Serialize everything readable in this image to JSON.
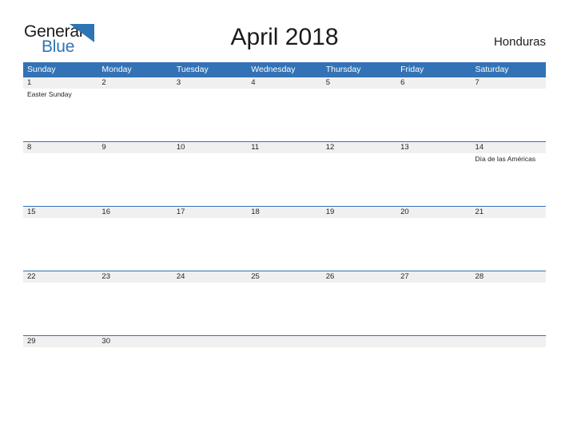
{
  "brand": {
    "name_part1": "General",
    "name_part2": "Blue",
    "triangle_icon": "triangle-right-icon",
    "accent_color": "#2e74b5"
  },
  "header": {
    "title": "April 2018",
    "country": "Honduras"
  },
  "colors": {
    "header_blue": "#3372b4",
    "row_band_gray": "#f0f0f0",
    "text": "#231f20",
    "header_text": "#ffffff"
  },
  "calendar": {
    "month": "April",
    "year": "2018",
    "day_headers": [
      "Sunday",
      "Monday",
      "Tuesday",
      "Wednesday",
      "Thursday",
      "Friday",
      "Saturday"
    ],
    "weeks": [
      {
        "days": [
          {
            "number": "1",
            "events": [
              "Easter Sunday"
            ]
          },
          {
            "number": "2",
            "events": []
          },
          {
            "number": "3",
            "events": []
          },
          {
            "number": "4",
            "events": []
          },
          {
            "number": "5",
            "events": []
          },
          {
            "number": "6",
            "events": []
          },
          {
            "number": "7",
            "events": []
          }
        ]
      },
      {
        "days": [
          {
            "number": "8",
            "events": []
          },
          {
            "number": "9",
            "events": []
          },
          {
            "number": "10",
            "events": []
          },
          {
            "number": "11",
            "events": []
          },
          {
            "number": "12",
            "events": []
          },
          {
            "number": "13",
            "events": []
          },
          {
            "number": "14",
            "events": [
              "Día de las Américas"
            ]
          }
        ]
      },
      {
        "days": [
          {
            "number": "15",
            "events": []
          },
          {
            "number": "16",
            "events": []
          },
          {
            "number": "17",
            "events": []
          },
          {
            "number": "18",
            "events": []
          },
          {
            "number": "19",
            "events": []
          },
          {
            "number": "20",
            "events": []
          },
          {
            "number": "21",
            "events": []
          }
        ]
      },
      {
        "days": [
          {
            "number": "22",
            "events": []
          },
          {
            "number": "23",
            "events": []
          },
          {
            "number": "24",
            "events": []
          },
          {
            "number": "25",
            "events": []
          },
          {
            "number": "26",
            "events": []
          },
          {
            "number": "27",
            "events": []
          },
          {
            "number": "28",
            "events": []
          }
        ]
      },
      {
        "days": [
          {
            "number": "29",
            "events": []
          },
          {
            "number": "30",
            "events": []
          },
          {
            "number": "",
            "events": []
          },
          {
            "number": "",
            "events": []
          },
          {
            "number": "",
            "events": []
          },
          {
            "number": "",
            "events": []
          },
          {
            "number": "",
            "events": []
          }
        ]
      }
    ]
  }
}
